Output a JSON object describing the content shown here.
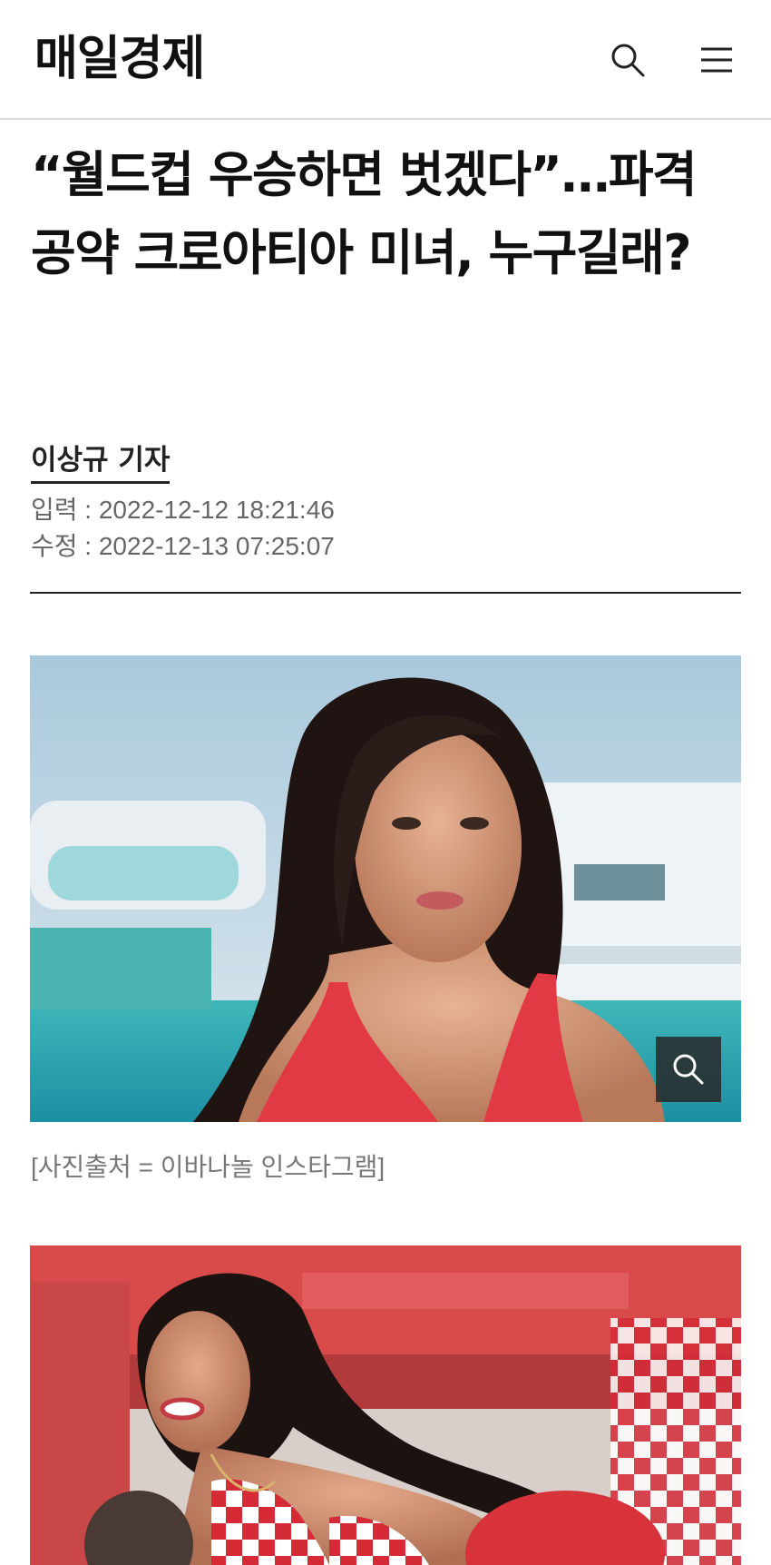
{
  "header": {
    "logo": "매일경제"
  },
  "article": {
    "headline": "“월드컵 우승하면 벗겠다”…파격 공약 크로아티아 미녀, 누구길래?",
    "byline": "이상규 기자",
    "published_label": "입력 : 2022-12-12 18:21:46",
    "modified_label": "수정 : 2022-12-13 07:25:07",
    "photo_caption": "[사진출처 = 이바나놀 인스타그램]"
  },
  "icons": {
    "search": "search-icon",
    "menu": "hamburger-menu-icon",
    "zoom": "magnifier-zoom-icon"
  },
  "colors": {
    "text": "#111111",
    "meta": "#666666",
    "caption": "#777777",
    "accent_red": "#e23a44"
  }
}
